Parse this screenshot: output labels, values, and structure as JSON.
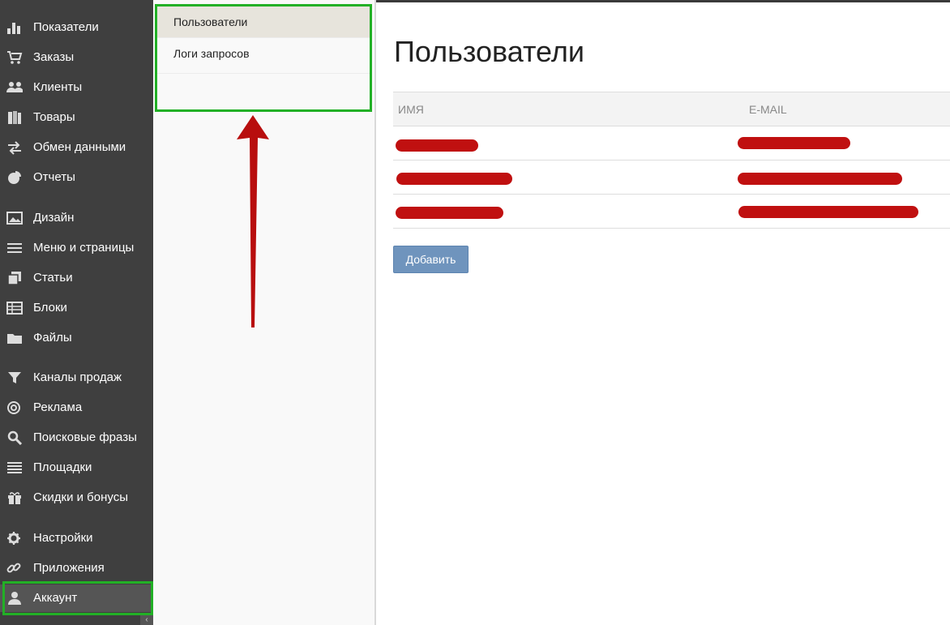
{
  "sidebar": {
    "items": [
      {
        "label": "Показатели",
        "icon": "bar-chart-icon"
      },
      {
        "label": "Заказы",
        "icon": "cart-icon"
      },
      {
        "label": "Клиенты",
        "icon": "users-icon"
      },
      {
        "label": "Товары",
        "icon": "books-icon"
      },
      {
        "label": "Обмен данными",
        "icon": "exchange-icon"
      },
      {
        "label": "Отчеты",
        "icon": "pie-chart-icon"
      },
      {
        "label": "Дизайн",
        "icon": "image-icon"
      },
      {
        "label": "Меню и страницы",
        "icon": "menu-icon"
      },
      {
        "label": "Статьи",
        "icon": "pages-icon"
      },
      {
        "label": "Блоки",
        "icon": "table-icon"
      },
      {
        "label": "Файлы",
        "icon": "folder-icon"
      },
      {
        "label": "Каналы продаж",
        "icon": "funnel-icon"
      },
      {
        "label": "Реклама",
        "icon": "target-icon"
      },
      {
        "label": "Поисковые фразы",
        "icon": "search-icon"
      },
      {
        "label": "Площадки",
        "icon": "list-icon"
      },
      {
        "label": "Скидки и бонусы",
        "icon": "gift-icon"
      },
      {
        "label": "Настройки",
        "icon": "gear-icon"
      },
      {
        "label": "Приложения",
        "icon": "link-icon"
      },
      {
        "label": "Аккаунт",
        "icon": "user-icon",
        "active": true
      }
    ],
    "collapse_glyph": "‹"
  },
  "submenu": {
    "items": [
      {
        "label": "Пользователи",
        "active": true
      },
      {
        "label": "Логи запросов"
      }
    ]
  },
  "main": {
    "title": "Пользователи",
    "table": {
      "columns": [
        "ИМЯ",
        "E-MAIL"
      ],
      "row_count": 3,
      "rows_note": "values redacted"
    },
    "add_button": "Добавить"
  },
  "colors": {
    "sidebar_bg": "#3f3f3f",
    "highlight": "#22b026",
    "redaction": "#c01010",
    "button": "#6f94bd",
    "arrow": "#b80e0e"
  }
}
